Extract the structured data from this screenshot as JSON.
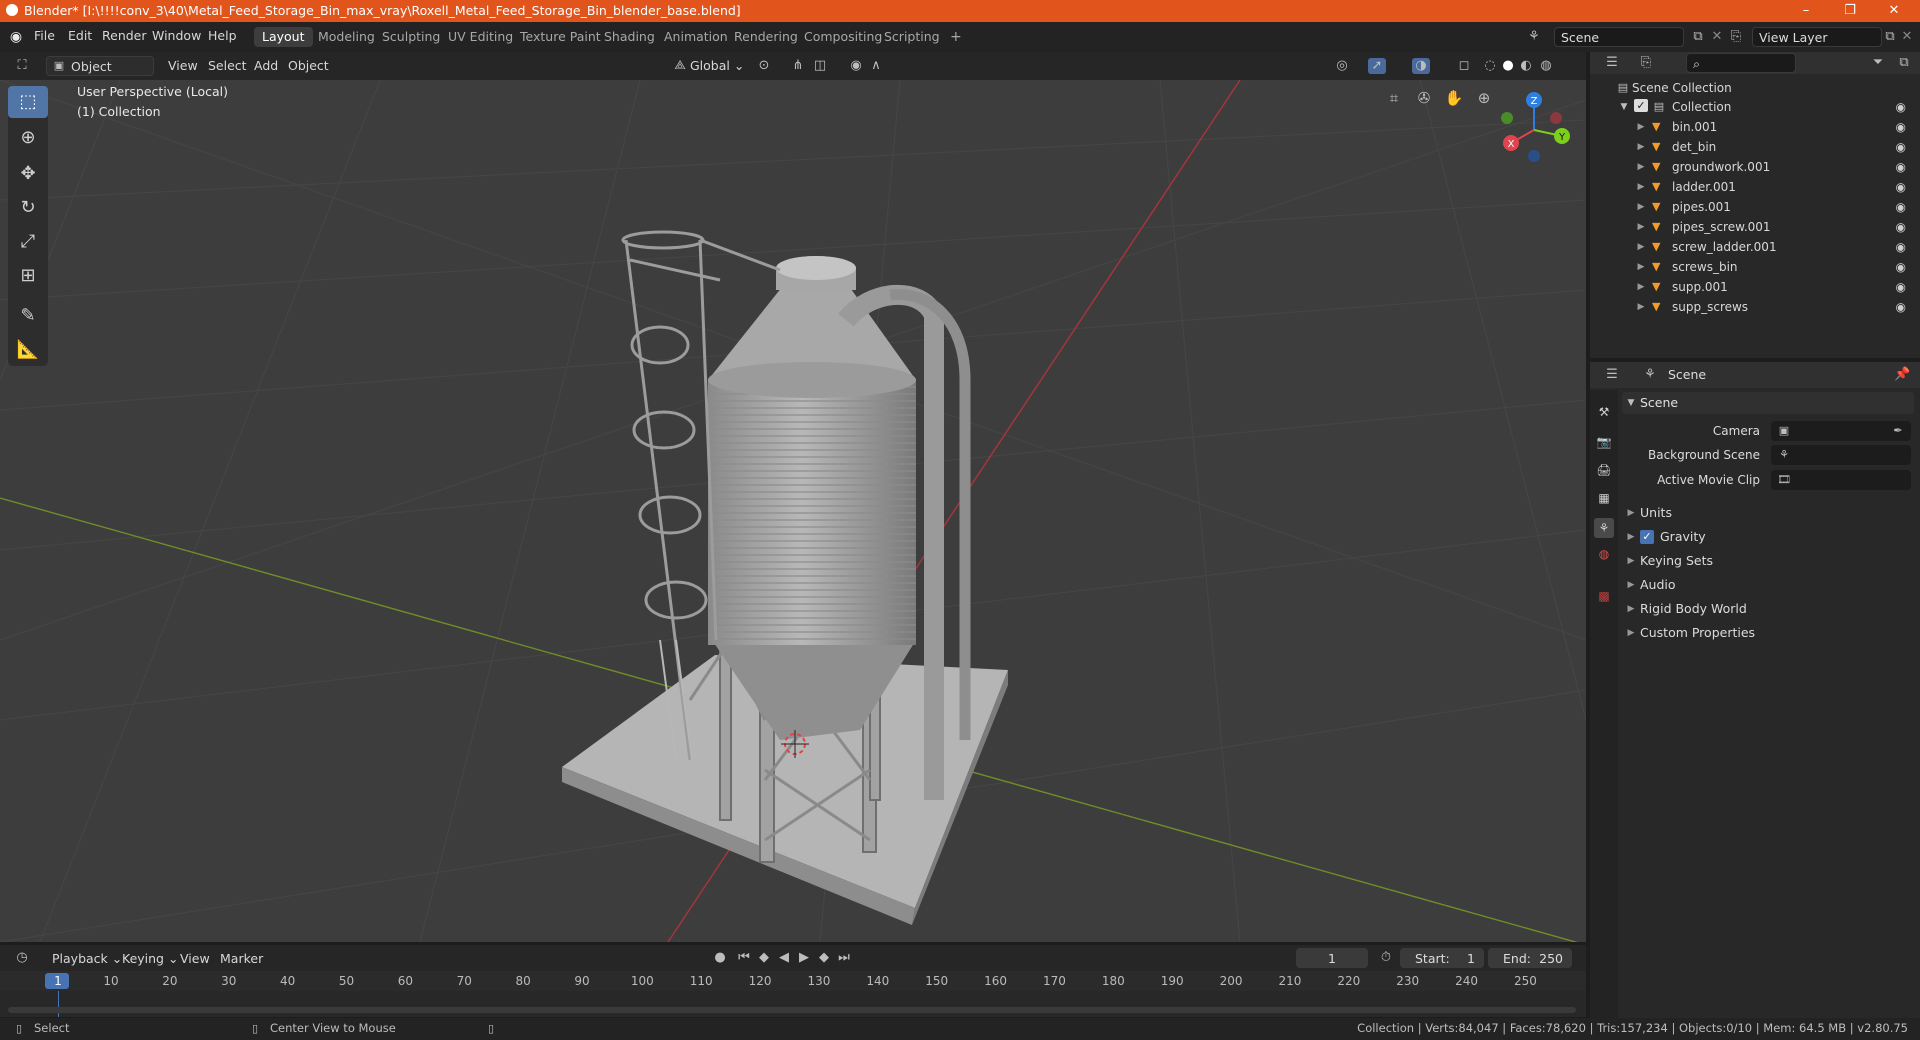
{
  "window": {
    "title": "Blender* [I:\\!!!!conv_3\\40\\Metal_Feed_Storage_Bin_max_vray\\Roxell_Metal_Feed_Storage_Bin_blender_base.blend]",
    "minimize": "–",
    "maximize": "❐",
    "close": "✕"
  },
  "menu": {
    "items": [
      "File",
      "Edit",
      "Render",
      "Window",
      "Help"
    ],
    "workspaces": [
      "Layout",
      "Modeling",
      "Sculpting",
      "UV Editing",
      "Texture Paint",
      "Shading",
      "Animation",
      "Rendering",
      "Compositing",
      "Scripting"
    ],
    "active_workspace": "Layout",
    "add_tab": "+",
    "scene_name": "Scene",
    "view_layer": "View Layer"
  },
  "viewport_header": {
    "mode": "Object Mode",
    "items": [
      "View",
      "Select",
      "Add",
      "Object"
    ],
    "transform_orientation": "Global"
  },
  "viewport": {
    "perspective_label": "User Perspective (Local)",
    "collection_label": "(1) Collection",
    "gizmo": {
      "x": "X",
      "y": "Y",
      "z": "Z"
    }
  },
  "toolbar": {
    "tools": [
      "select-box-icon",
      "cursor-icon",
      "move-icon",
      "rotate-icon",
      "scale-icon",
      "transform-icon",
      "annotate-icon",
      "measure-icon"
    ]
  },
  "outliner": {
    "root": "Scene Collection",
    "collection": "Collection",
    "objects": [
      "bin.001",
      "det_bin",
      "groundwork.001",
      "ladder.001",
      "pipes.001",
      "pipes_screw.001",
      "screw_ladder.001",
      "screws_bin",
      "supp.001",
      "supp_screws"
    ]
  },
  "properties": {
    "context": "Scene",
    "panel_title": "Scene",
    "fields": [
      {
        "label": "Camera"
      },
      {
        "label": "Background Scene"
      },
      {
        "label": "Active Movie Clip"
      }
    ],
    "sections": [
      "Units",
      "Gravity",
      "Keying Sets",
      "Audio",
      "Rigid Body World",
      "Custom Properties"
    ],
    "gravity_checked": true
  },
  "timeline": {
    "menus": [
      "Playback",
      "Keying",
      "View",
      "Marker"
    ],
    "current_frame": "1",
    "start_label": "Start:",
    "start": "1",
    "end_label": "End:",
    "end": "250",
    "ruler": [
      "1",
      "10",
      "20",
      "30",
      "40",
      "50",
      "60",
      "70",
      "80",
      "90",
      "100",
      "110",
      "120",
      "130",
      "140",
      "150",
      "160",
      "170",
      "180",
      "190",
      "200",
      "210",
      "220",
      "230",
      "240",
      "250"
    ]
  },
  "statusbar": {
    "left": "Select",
    "middle": "Center View to Mouse",
    "stats": "Collection | Verts:84,047 | Faces:78,620 | Tris:157,234 | Objects:0/10 | Mem: 64.5 MB | v2.80.75"
  },
  "colors": {
    "titlebar": "#e1541c",
    "accent": "#5275a8",
    "x_axis": "#e0444f",
    "y_axis": "#7ccf1c",
    "z_axis": "#2f7fe0"
  }
}
